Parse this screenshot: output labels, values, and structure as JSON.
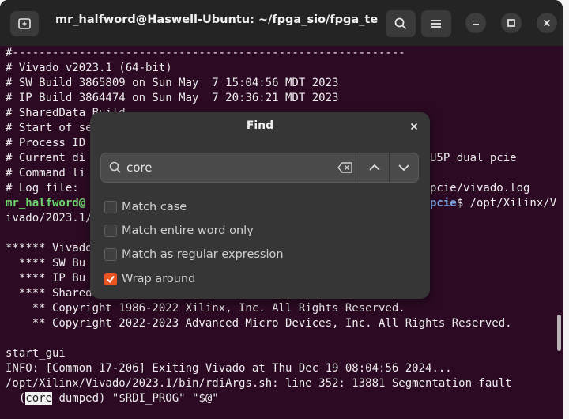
{
  "window": {
    "title": "mr_halfword@Haswell-Ubuntu: ~/fpga_sio/fpga_te..."
  },
  "terminal": {
    "lines": [
      "#-----------------------------------------------------------",
      "# Vivado v2023.1 (64-bit)",
      "# SW Build 3865809 on Sun May  7 15:04:56 MDT 2023",
      "# IP Build 3864474 on Sun May  7 20:36:21 MDT 2023",
      "# SharedData Build",
      "# Start of se",
      "# Process ID",
      "# Current di",
      "# Command li",
      "# Log file: ",
      "",
      "ivado/2023.1/",
      "",
      "****** Vivado",
      "  **** SW Bu",
      "  **** IP Bu",
      "  **** SharedData Build 3865790 on Sun May 07 15:35:03 MDT 2023",
      "    ** Copyright 1986-2022 Xilinx, Inc. All Rights Reserved.",
      "    ** Copyright 2022-2023 Advanced Micro Devices, Inc. All Rights Reserved.",
      "",
      "start_gui",
      "INFO: [Common 17-206] Exiting Vivado at Thu Dec 19 08:04:56 2024...",
      "/opt/Xilinx/Vivado/2023.1/bin/rdiArgs.sh: line 352: 13881 Segmentation fault"
    ],
    "line7_tail": "U5P_dual_pcie",
    "line9_tail": "pcie/vivado.log",
    "prompt_user": "mr_halfword@",
    "prompt_path_tail": "pcie",
    "prompt_cmd": "$ /opt/Xilinx/V",
    "last_pre": "  (",
    "last_hl": "core",
    "last_post": " dumped) \"$RDI_PROG\" \"$@\""
  },
  "find_dialog": {
    "title": "Find",
    "search_value": "core",
    "options": [
      {
        "label": "Match case",
        "checked": false
      },
      {
        "label": "Match entire word only",
        "checked": false
      },
      {
        "label": "Match as regular expression",
        "checked": false
      },
      {
        "label": "Wrap around",
        "checked": true
      }
    ]
  },
  "colors": {
    "terminal_bg": "#2c0a23",
    "accent": "#e95420",
    "prompt_user": "#6ed36e",
    "prompt_path": "#7aa5e8"
  },
  "icons": [
    "new-tab-icon",
    "search-icon",
    "menu-icon",
    "minimize-icon",
    "maximize-icon",
    "close-icon",
    "clear-icon",
    "chevron-up-icon",
    "chevron-down-icon",
    "check-icon"
  ]
}
